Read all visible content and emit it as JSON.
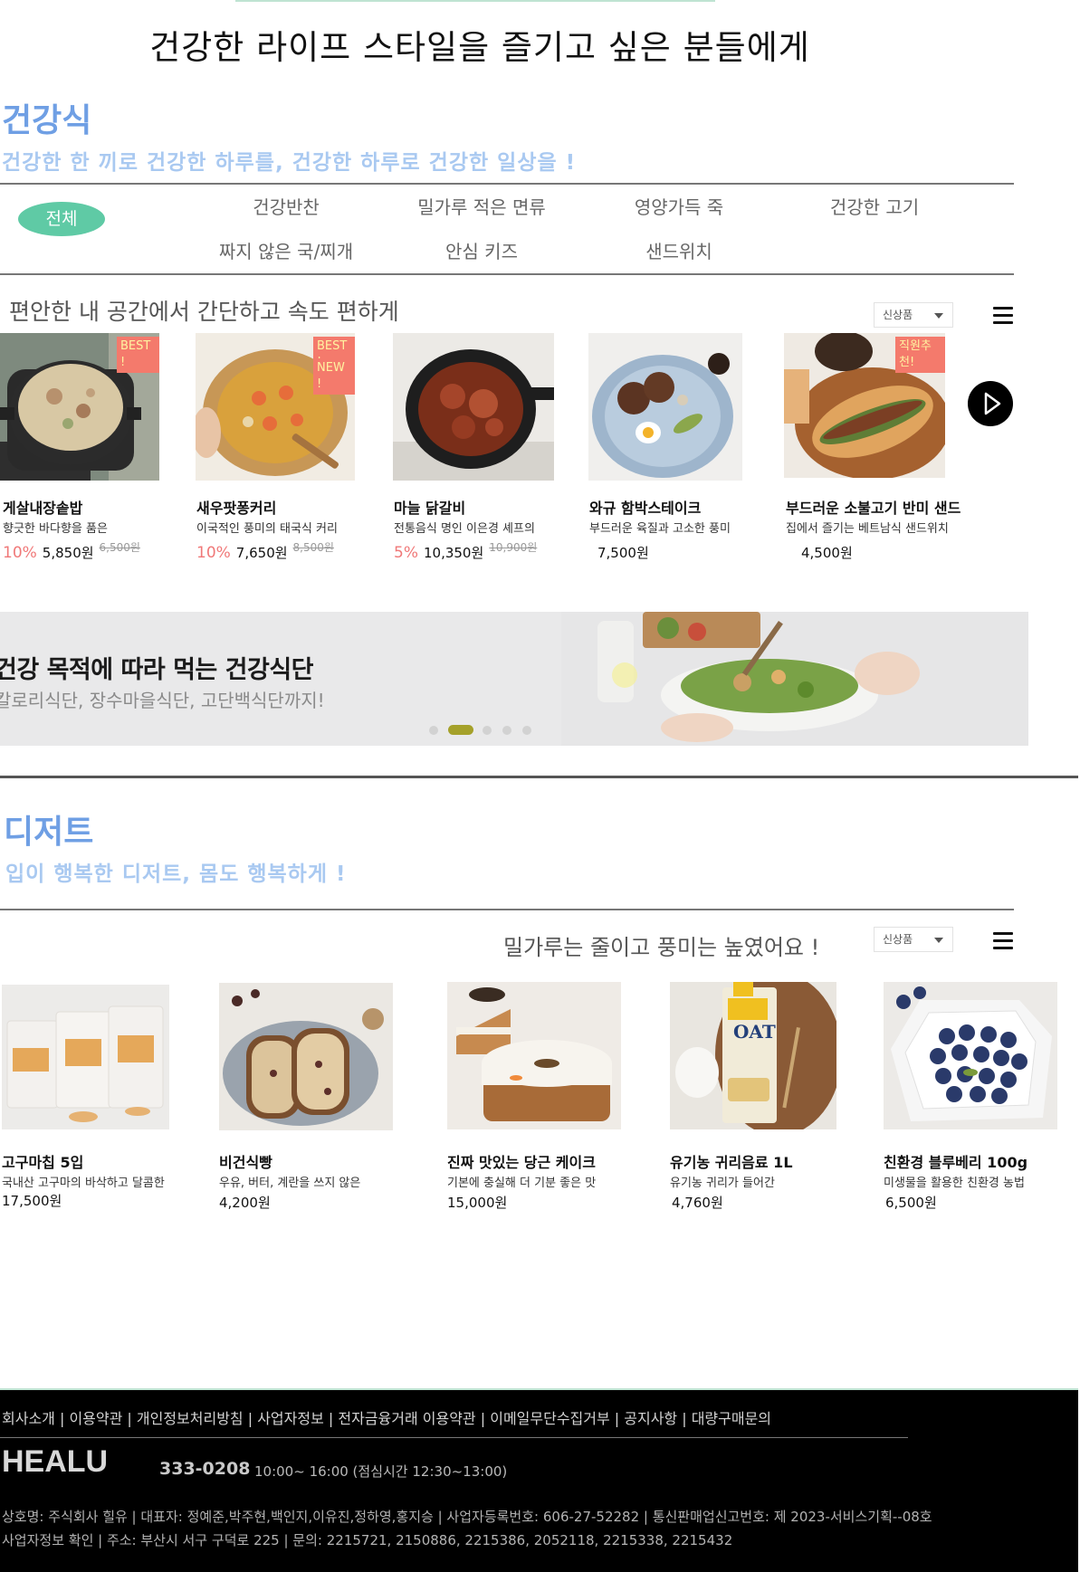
{
  "headline": "건강한 라이프 스타일을 즐기고 싶은 분들에게",
  "healthy": {
    "title": "건강식",
    "subtitle": "건강한 한 끼로 건강한 하루를, 건강한 하루로 건강한 일상을 !",
    "categories_active": "전체",
    "categories_row1": [
      "건강반찬",
      "밀가루 적은 면류",
      "영양가득 죽",
      "건강한 고기"
    ],
    "categories_row2": [
      "짜지 않은 국/찌개",
      "안심 키즈",
      "샌드위치"
    ],
    "row_title": "편안한 내 공간에서 간단하고 속도 편하게",
    "sort_label": "신상품",
    "products": [
      {
        "name": "게살내장솥밥",
        "desc": "향긋한 바다향을 품은",
        "discount": "10%",
        "price": "5,850원",
        "original": "6,500원",
        "badges": [
          "BEST !"
        ]
      },
      {
        "name": "새우팟퐁커리",
        "desc": "이국적인 풍미의 태국식 커리",
        "discount": "10%",
        "price": "7,650원",
        "original": "8,500원",
        "badges": [
          "BEST !",
          "NEW !"
        ]
      },
      {
        "name": "마늘 닭갈비",
        "desc": "전통음식 명인 이은경 셰프의",
        "discount": "5%",
        "price": "10,350원",
        "original": "10,900원",
        "badges": []
      },
      {
        "name": "와규 함박스테이크",
        "desc": "부드러운 육질과 고소한 풍미",
        "discount": "",
        "price": "7,500원",
        "original": "",
        "badges": []
      },
      {
        "name": "부드러운 소불고기 반미 샌드",
        "desc": "집에서 즐기는 베트남식 샌드위치",
        "discount": "",
        "price": "4,500원",
        "original": "",
        "badges": [
          "직원추천!"
        ]
      }
    ]
  },
  "banner": {
    "title": "건강 목적에 따라 먹는 건강식단",
    "subtitle": "칼로리식단, 장수마을식단, 고단백식단까지!",
    "active_slide": 2,
    "slide_count": 5
  },
  "dessert": {
    "title": "디저트",
    "subtitle": "입이 행복한 디저트, 몸도 행복하게 !",
    "row_title": "밀가루는 줄이고 풍미는 높였어요 !",
    "sort_label": "신상품",
    "products": [
      {
        "name": "고구마칩 5입",
        "desc": "국내산 고구마의 바삭하고 달콤한",
        "price": "17,500원"
      },
      {
        "name": "비건식빵",
        "desc": "우유, 버터, 계란을 쓰지 않은",
        "price": "4,200원"
      },
      {
        "name": "진짜 맛있는 당근 케이크",
        "desc": "기본에 충실해 더 기분 좋은 맛",
        "price": "15,000원"
      },
      {
        "name": "유기농 귀리음료 1L",
        "desc": "유기농 귀리가 들어간",
        "price": "4,760원"
      },
      {
        "name": "친환경 블루베리 100g",
        "desc": "미생물을 활용한 친환경 농법",
        "price": "6,500원"
      }
    ]
  },
  "footer": {
    "links": "회사소개 | 이용약관 | 개인정보처리방침 | 사업자정보 | 전자금융거래 이용약관 | 이메일무단수집거부 | 공지사항 | 대량구매문의",
    "logo": "HEALU",
    "phone": "333-0208",
    "hours": "10:00~ 16:00 (점심시간 12:30~13:00)",
    "info1": "상호명: 주식회사 힐유 | 대표자: 정예준,박주현,백인지,이유진,정하영,홍지승 | 사업자등록번호: 606-27-52282 | 통신판매업신고번호: 제 2023-서비스기획--08호",
    "info2": "사업자정보 확인 | 주소: 부산시 서구 구덕로 225 | 문의: 2215721, 2150886, 2215386, 2052118, 2215338, 2215432"
  },
  "colors": {
    "accent_blue": "#6f9fe4",
    "accent_green": "#5fcaa5",
    "discount_red": "#f07878",
    "footer_bg": "#000000"
  }
}
